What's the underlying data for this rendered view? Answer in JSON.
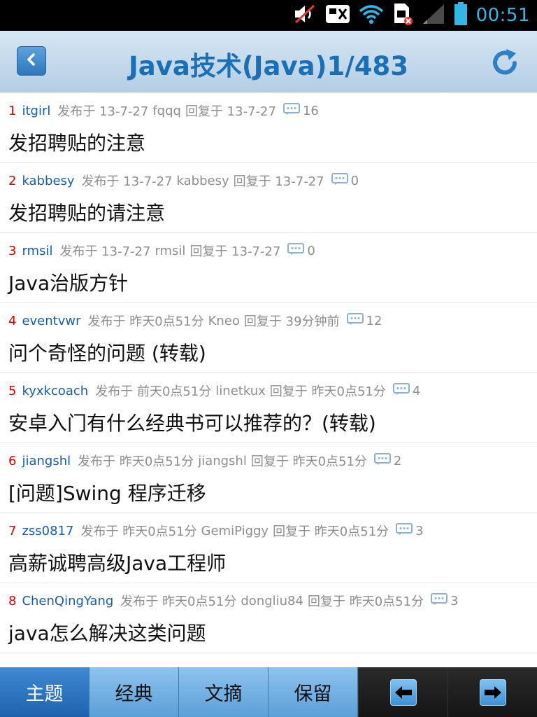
{
  "status_bar": {
    "time": "00:51",
    "icons": [
      "muted-speaker-icon",
      "notification-icon",
      "wifi-icon",
      "sim-error-icon",
      "signal-icon",
      "battery-icon"
    ]
  },
  "header": {
    "title": "Java技术(Java)1/483",
    "back_icon": "chevron-left-icon",
    "refresh_icon": "refresh-icon"
  },
  "posts": [
    {
      "index": "1",
      "author": "itgirl",
      "posted": "发布于 13-7-27",
      "replier": "fqqq",
      "replied": "回复于 13-7-27",
      "comments": "16",
      "title": "发招聘贴的注意"
    },
    {
      "index": "2",
      "author": "kabbesy",
      "posted": "发布于 13-7-27",
      "replier": "kabbesy",
      "replied": "回复于 13-7-27",
      "comments": "0",
      "title": "发招聘贴的请注意"
    },
    {
      "index": "3",
      "author": "rmsil",
      "posted": "发布于 13-7-27",
      "replier": "rmsil",
      "replied": "回复于 13-7-27",
      "comments": "0",
      "title": "Java治版方针"
    },
    {
      "index": "4",
      "author": "eventvwr",
      "posted": "发布于 昨天0点51分",
      "replier": "Kneo",
      "replied": "回复于 39分钟前",
      "comments": "12",
      "title": "问个奇怪的问题 (转载)"
    },
    {
      "index": "5",
      "author": "kyxkcoach",
      "posted": "发布于 前天0点51分",
      "replier": "linetkux",
      "replied": "回复于 昨天0点51分",
      "comments": "4",
      "title": "安卓入门有什么经典书可以推荐的？(转载)"
    },
    {
      "index": "6",
      "author": "jiangshl",
      "posted": "发布于 昨天0点51分",
      "replier": "jiangshl",
      "replied": "回复于 昨天0点51分",
      "comments": "2",
      "title": "[问题]Swing 程序迁移"
    },
    {
      "index": "7",
      "author": "zss0817",
      "posted": "发布于 昨天0点51分",
      "replier": "GemiPiggy",
      "replied": "回复于 昨天0点51分",
      "comments": "3",
      "title": "高薪诚聘高级Java工程师"
    },
    {
      "index": "8",
      "author": "ChenQingYang",
      "posted": "发布于 昨天0点51分",
      "replier": "dongliu84",
      "replied": "回复于 昨天0点51分",
      "comments": "3",
      "title": "java怎么解决这类问题"
    }
  ],
  "tabs": [
    "主题",
    "经典",
    "文摘",
    "保留"
  ],
  "nav": {
    "prev_icon": "arrow-left-icon",
    "next_icon": "arrow-right-icon"
  },
  "colors": {
    "accent": "#1b6fb5",
    "index_red": "#d80000",
    "author_blue": "#1a5fa3",
    "meta_gray": "#8e8e8e",
    "active_tab": "#1e62ad"
  }
}
